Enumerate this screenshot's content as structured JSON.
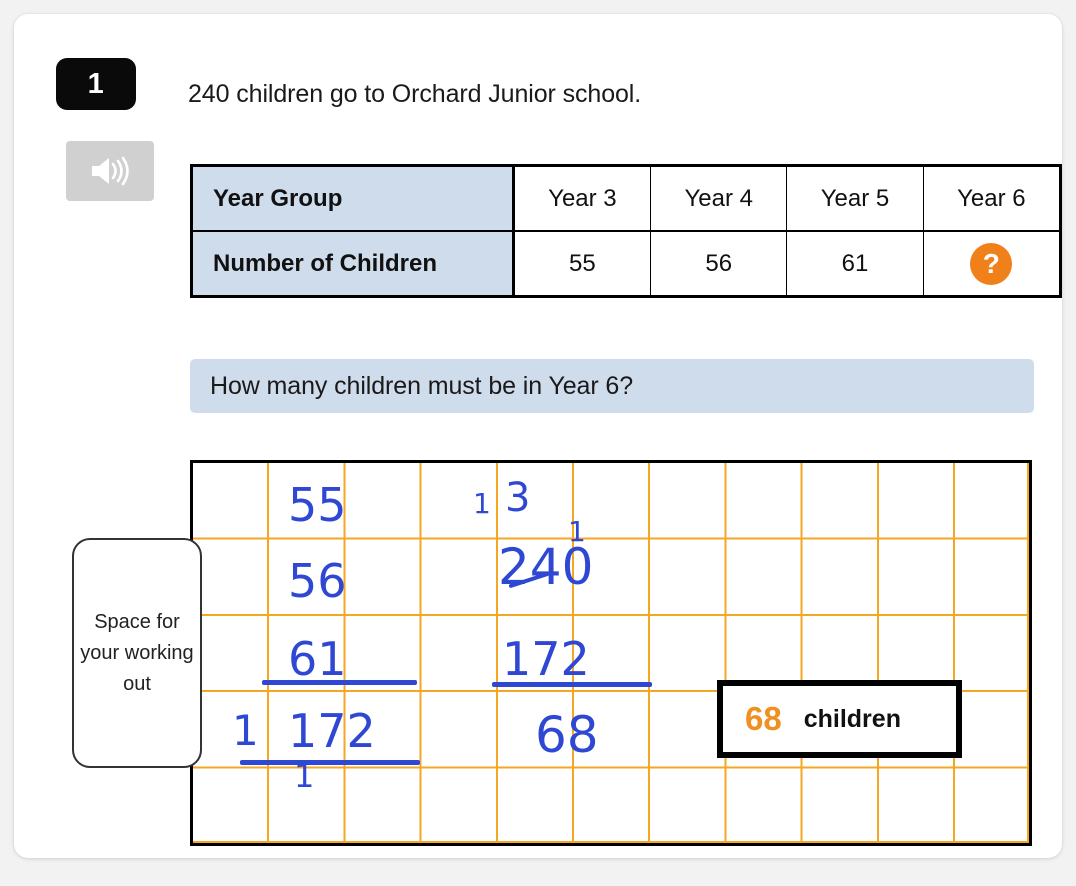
{
  "question": {
    "number": "1",
    "audio_icon": "speaker-icon",
    "statement": "240 children go to Orchard Junior school.",
    "prompt": "How many children must be in Year 6?"
  },
  "table": {
    "row_labels": [
      "Year Group",
      "Number of Children"
    ],
    "year_headers": [
      "Year 3",
      "Year 4",
      "Year 5",
      "Year 6"
    ],
    "counts": [
      "55",
      "56",
      "61"
    ],
    "unknown_marker": "?",
    "label_bg": "#cfdcec",
    "unknown_color": "#f08019"
  },
  "working": {
    "label": "Space for your working out",
    "ink_color": "#2f48d4",
    "grid_color": "#f5a623",
    "addition": {
      "addends": [
        "55",
        "56",
        "61"
      ],
      "total": "172",
      "carry": [
        "1",
        "1"
      ]
    },
    "subtraction": {
      "minuend": "240",
      "exchange_marks": [
        "1",
        "3",
        "1"
      ],
      "subtrahend": "172",
      "difference": "68"
    }
  },
  "answer": {
    "value": "68",
    "unit": "children",
    "value_color": "#f09020"
  }
}
